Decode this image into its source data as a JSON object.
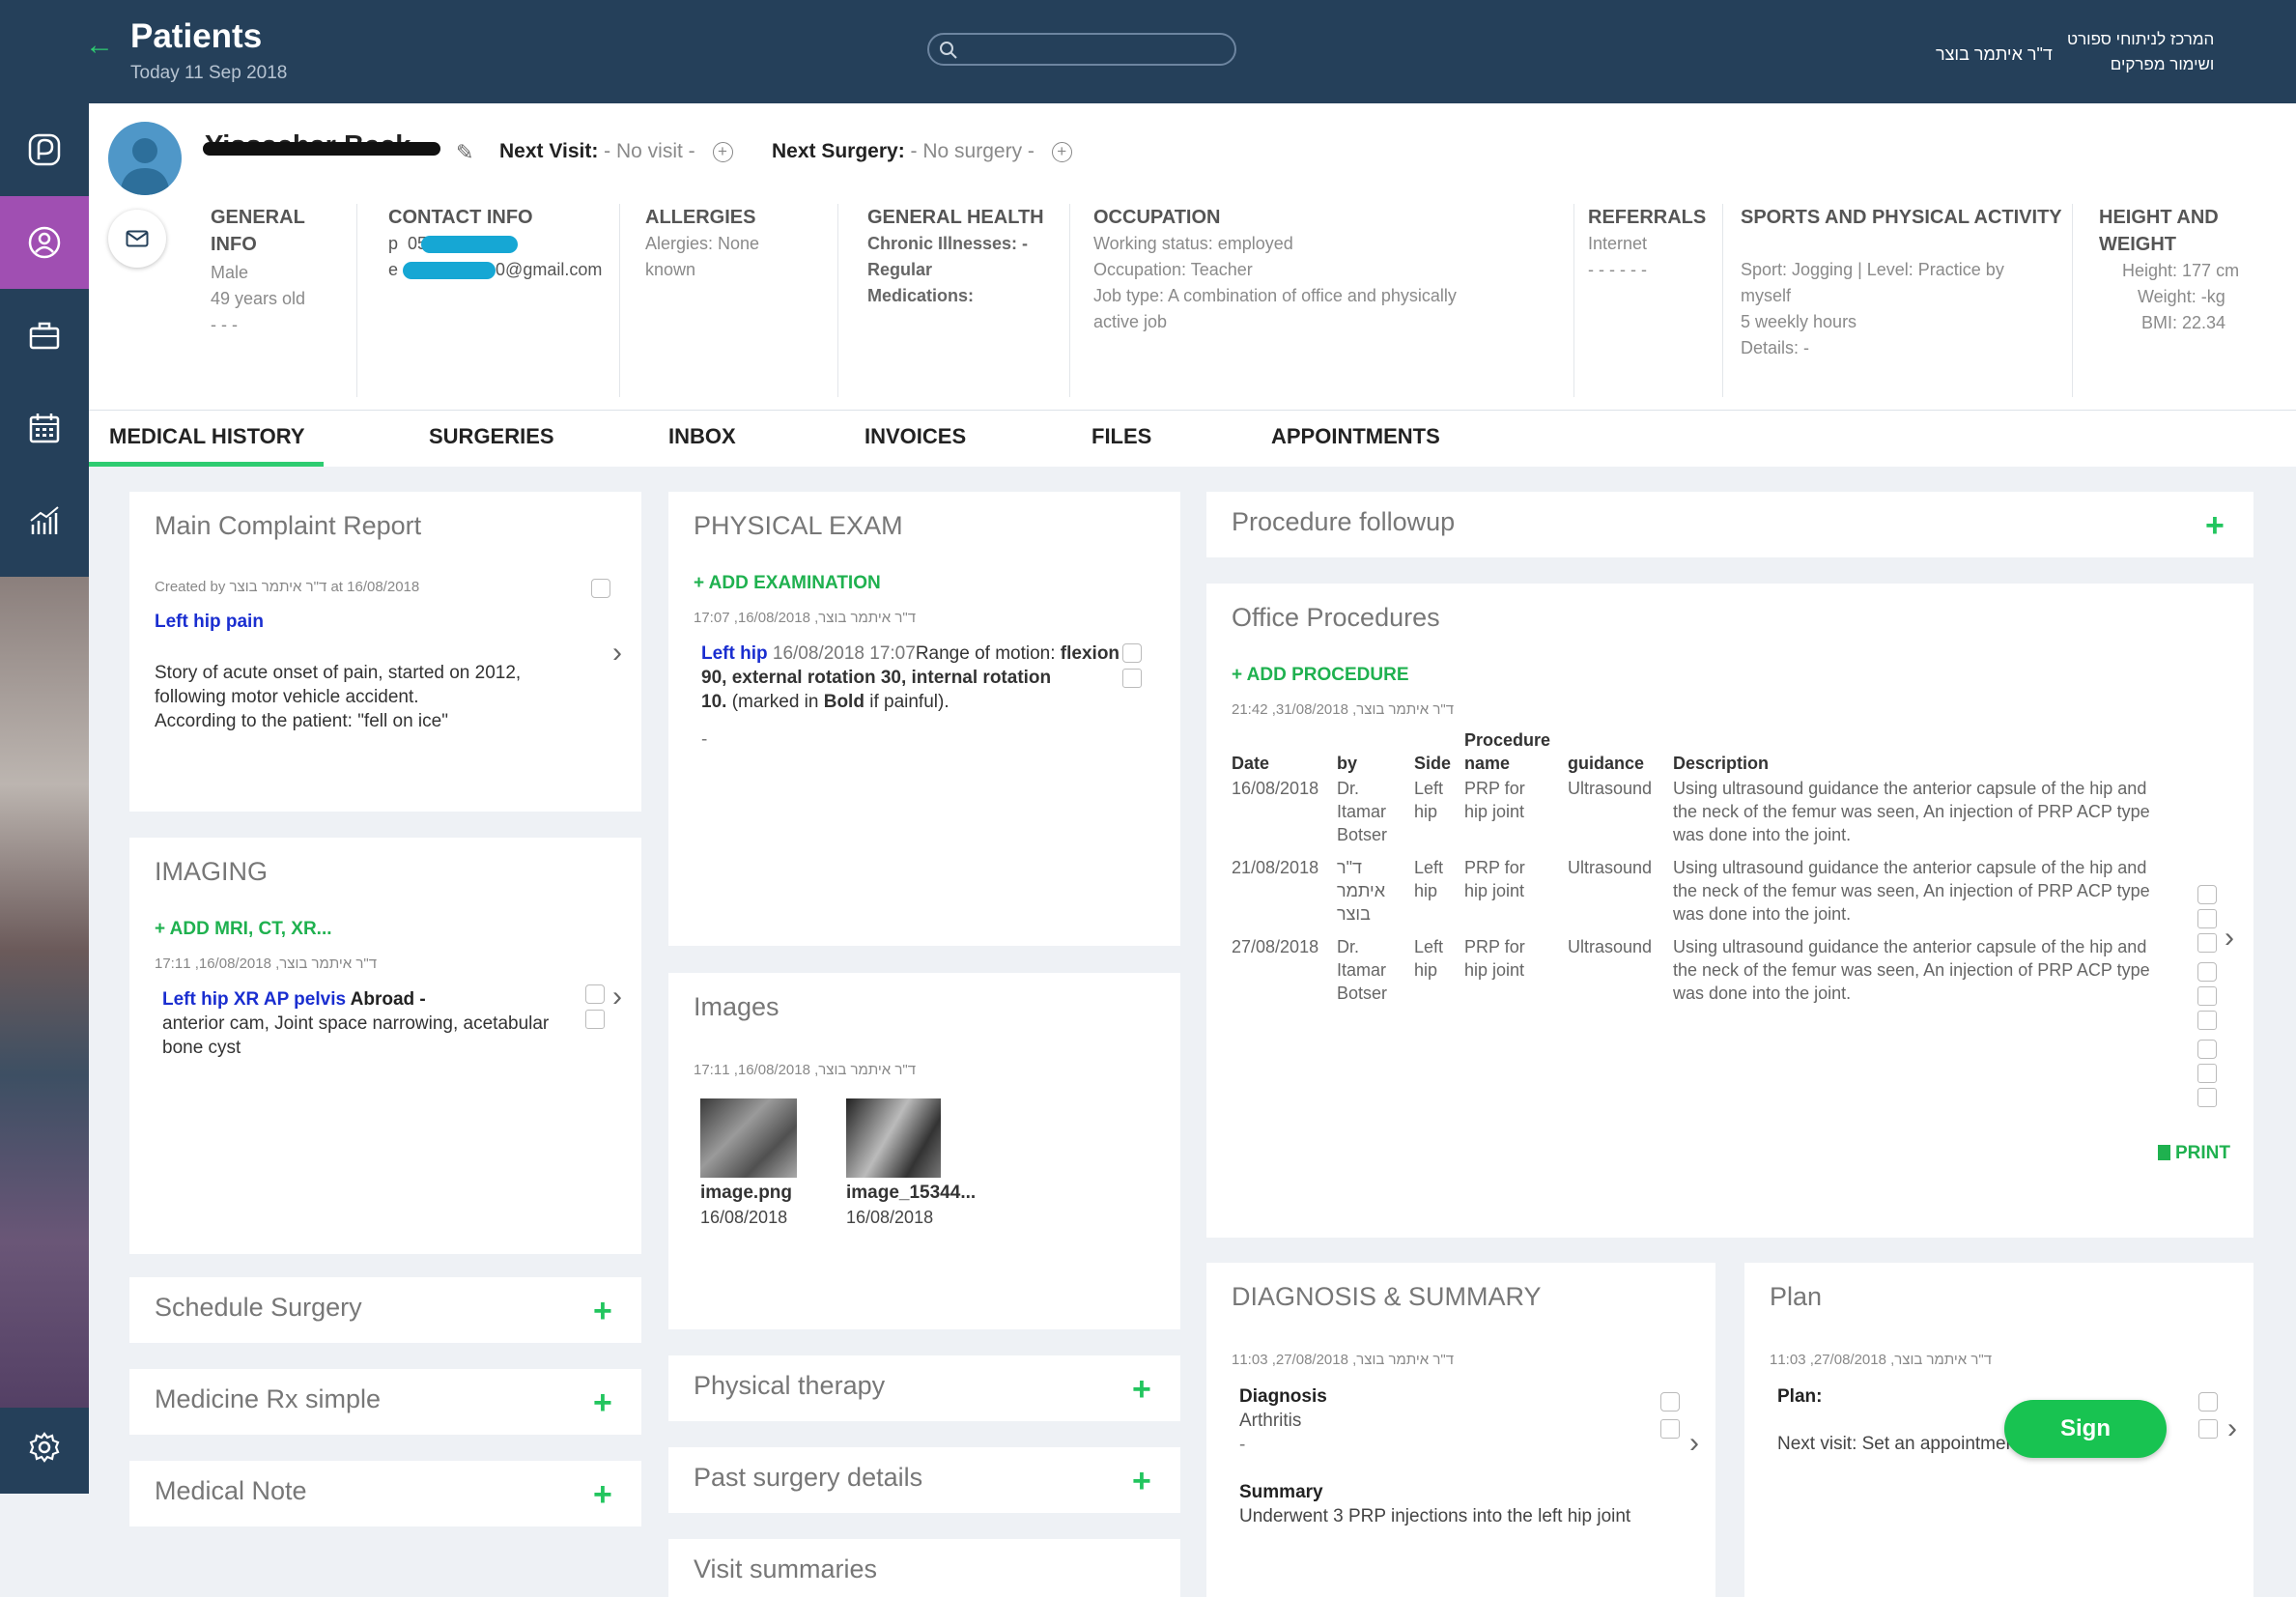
{
  "header": {
    "title": "Patients",
    "date": "Today 11 Sep 2018",
    "doctor": "ד\"ר איתמר בוצר",
    "clinic_line1": "המרכז לניתוחי ספורט",
    "clinic_line2": "ושימור מפרקים"
  },
  "patient": {
    "name": "Yissachar Beck",
    "next_visit_label": "Next Visit:",
    "next_visit_value": " - No visit - ",
    "next_surgery_label": "Next Surgery:",
    "next_surgery_value": " - No surgery - "
  },
  "info": {
    "general": {
      "h1": "GENERAL",
      "h2": "INFO",
      "sex": "Male",
      "age": "49 years old",
      "dash": "- - -"
    },
    "contact": {
      "h": "CONTACT INFO",
      "phone_prefix": "p",
      "phone_start": "05",
      "email_prefix": "e",
      "email_end": "0@gmail.com"
    },
    "allergies": {
      "h": "ALLERGIES",
      "l1": "Alergies: None",
      "l2": "known"
    },
    "health": {
      "h": "GENERAL HEALTH",
      "l1": "Chronic Illnesses: -",
      "l2": "Regular",
      "l3": "Medications:"
    },
    "occupation": {
      "h": "OCCUPATION",
      "l1": "Working status: employed",
      "l2": "Occupation: Teacher",
      "l3": "Job type: A combination of office and physically",
      "l4": "active job"
    },
    "referrals": {
      "h": "REFERRALS",
      "l1": "Internet",
      "l2": "- - - - - -"
    },
    "sports": {
      "h": "SPORTS AND PHYSICAL ACTIVITY",
      "l1": "Sport: Jogging | Level: Practice by",
      "l2": "myself",
      "l3": "5 weekly hours",
      "l4": "Details: -"
    },
    "hw": {
      "h1": "HEIGHT AND",
      "h2": "WEIGHT",
      "l1": "Height: 177 cm",
      "l2": "Weight: -kg",
      "l3": "BMI: 22.34"
    }
  },
  "tabs": [
    "MEDICAL HISTORY",
    "SURGERIES",
    "INBOX",
    "INVOICES",
    "FILES",
    "APPOINTMENTS"
  ],
  "complaint": {
    "title": "Main Complaint Report",
    "meta_pre": "Created by",
    "meta_doc": "ד\"ר איתמר בוצר",
    "meta_post": "at 16/08/2018",
    "headline": "Left hip pain",
    "l1": "Story of acute onset of pain, started on 2012,",
    "l2": "following motor vehicle accident.",
    "l3": "According to the patient: \"fell on ice\""
  },
  "imaging": {
    "title": "IMAGING",
    "add": "+ ADD MRI, CT, XR...",
    "meta": "17:11 ,16/08/2018 ,ד\"ר איתמר בוצר",
    "item_blue": "Left hip XR AP pelvis",
    "item_bold": " Abroad -",
    "l1": "anterior cam, Joint space narrowing, acetabular",
    "l2": "bone cyst"
  },
  "left_cards": [
    "Schedule Surgery",
    "Medicine Rx simple",
    "Medical Note"
  ],
  "exam": {
    "title": "PHYSICAL EXAM",
    "add": "+ ADD EXAMINATION",
    "meta": "17:07 ,16/08/2018 ,ד\"ר איתמר בוצר",
    "blue": "Left hip",
    "time": " 16/08/2018 17:07",
    "rom": "Range of motion: ",
    "flex": "flexion",
    "l2": "90, external rotation 30, internal rotation",
    "l3a": "10.",
    "l3b": " (marked in ",
    "l3c": "Bold",
    "l3d": " if painful).",
    "dash": "-"
  },
  "images": {
    "title": "Images",
    "meta": "17:11 ,16/08/2018 ,ד\"ר איתמר בוצר",
    "items": [
      {
        "name": "image.png",
        "date": "16/08/2018"
      },
      {
        "name": "image_15344...",
        "date": "16/08/2018"
      }
    ]
  },
  "mid_cards": [
    "Physical therapy",
    "Past surgery details",
    "Visit summaries"
  ],
  "followup": {
    "title": "Procedure followup"
  },
  "office": {
    "title": "Office Procedures",
    "add": "+ ADD PROCEDURE",
    "meta": "21:42 ,31/08/2018 ,ד\"ר איתמר בוצר",
    "print": "PRINT",
    "headers": {
      "date": "Date",
      "by": "by",
      "side": "Side",
      "name1": "Procedure",
      "name2": "name",
      "guidance": "guidance",
      "desc": "Description"
    },
    "rows": [
      {
        "date": "16/08/2018",
        "by": [
          "Dr.",
          "Itamar",
          "Botser"
        ],
        "side": [
          "Left",
          "hip"
        ],
        "name": [
          "PRP for",
          "hip joint"
        ],
        "guidance": "Ultrasound",
        "desc": [
          "Using ultrasound guidance the anterior capsule of the hip and",
          "the neck of the femur was seen, An injection of PRP ACP type",
          "was done into the joint."
        ]
      },
      {
        "date": "21/08/2018",
        "by": [
          "ד\"ר",
          "איתמר",
          "בוצר"
        ],
        "side": [
          "Left",
          "hip"
        ],
        "name": [
          "PRP for",
          "hip joint"
        ],
        "guidance": "Ultrasound",
        "desc": [
          "Using ultrasound guidance the anterior capsule of the hip and",
          "the neck of the femur was seen, An injection of PRP ACP type",
          "was done into the joint."
        ]
      },
      {
        "date": "27/08/2018",
        "by": [
          "Dr.",
          "Itamar",
          "Botser"
        ],
        "side": [
          "Left",
          "hip"
        ],
        "name": [
          "PRP for",
          "hip joint"
        ],
        "guidance": "Ultrasound",
        "desc": [
          "Using ultrasound guidance the anterior capsule of the hip and",
          "the neck of the femur was seen, An injection of PRP ACP type",
          "was done into the joint."
        ]
      }
    ]
  },
  "diagnosis": {
    "title": "DIAGNOSIS & SUMMARY",
    "meta": "11:03 ,27/08/2018 ,ד\"ר איתמר בוצר",
    "dlabel": "Diagnosis",
    "dval": "Arthritis",
    "ddash": "-",
    "slabel": "Summary",
    "sval": "Underwent 3 PRP injections into the left hip joint"
  },
  "plan": {
    "title": "Plan",
    "meta": "11:03 ,27/08/2018 ,ד\"ר איתמר בוצר",
    "label": "Plan:",
    "text": "Next visit: Set an appointment if needed",
    "sign": "Sign"
  },
  "colors": {
    "nav": "#25405a",
    "accent_green": "#2ecc71",
    "active_nav": "#a04fb2",
    "link_blue": "#1a2ed0"
  }
}
